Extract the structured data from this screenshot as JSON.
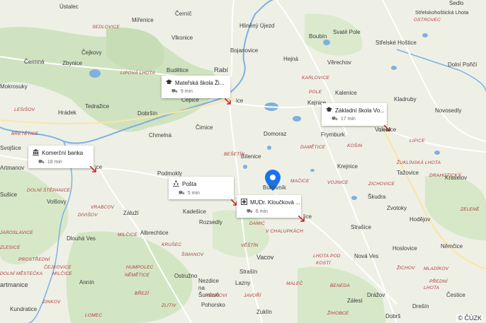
{
  "colors": {
    "land": "#eef0e6",
    "forest": "#cfe3c1",
    "water": "#7fb0df",
    "road": "#ffffff",
    "road_major": "#fbe5a3",
    "pin": "#1a73e8",
    "arrow": "#c62828"
  },
  "towns": [
    {
      "id": "ustalec",
      "name": "Ústalec"
    },
    {
      "id": "cernic",
      "name": "Černíč"
    },
    {
      "id": "sedlo",
      "name": "Sedlo"
    },
    {
      "id": "mirenice",
      "name": "Mířenice"
    },
    {
      "id": "hlineny",
      "name": "Hliněný Újezd"
    },
    {
      "id": "boubin",
      "name": "Boubín"
    },
    {
      "id": "svate-pole",
      "name": "Svaté Pole"
    },
    {
      "id": "strelskohost",
      "name": "Střelskohoštická Lhota"
    },
    {
      "id": "vlkonice",
      "name": "Vlkonice"
    },
    {
      "id": "strelske",
      "name": "Střelské Hoštice"
    },
    {
      "id": "bojanovice",
      "name": "Bojanovice"
    },
    {
      "id": "cejkovy",
      "name": "Čejkovy"
    },
    {
      "id": "hejna",
      "name": "Hejná"
    },
    {
      "id": "cermna",
      "name": "Čermná"
    },
    {
      "id": "zbynice",
      "name": "Zbynice"
    },
    {
      "id": "verechov",
      "name": "Věrechov"
    },
    {
      "id": "dolni-ponci",
      "name": "Dolní Poňčí"
    },
    {
      "id": "budetice",
      "name": "Budětice"
    },
    {
      "id": "rabi",
      "name": "Rabí"
    },
    {
      "id": "mokrosuky",
      "name": "Mokrosuky"
    },
    {
      "id": "kalenice",
      "name": "Kalenice"
    },
    {
      "id": "tedrazice",
      "name": "Tedražice"
    },
    {
      "id": "cepice",
      "name": "Čepice"
    },
    {
      "id": "kejnice",
      "name": "Kejnice"
    },
    {
      "id": "kladruby",
      "name": "Kladruby"
    },
    {
      "id": "hradek",
      "name": "Hrádek"
    },
    {
      "id": "dobrsin",
      "name": "Dobršín"
    },
    {
      "id": "novosedly",
      "name": "Novosedly"
    },
    {
      "id": "cimice",
      "name": "Čimice"
    },
    {
      "id": "chmelna",
      "name": "Chmelná"
    },
    {
      "id": "domoraz",
      "name": "Domoraz"
    },
    {
      "id": "frymburk",
      "name": "Frymburk"
    },
    {
      "id": "volenice",
      "name": "Volenice"
    },
    {
      "id": "svojsice",
      "name": "Svojšice"
    },
    {
      "id": "bilenice",
      "name": "Bílenice"
    },
    {
      "id": "artmanov",
      "name": "Artmanov"
    },
    {
      "id": "krejnice",
      "name": "Krejnice"
    },
    {
      "id": "tazovice",
      "name": "Tažovice"
    },
    {
      "id": "podmokly",
      "name": "Podmokly"
    },
    {
      "id": "kraselov",
      "name": "Kraselov"
    },
    {
      "id": "bukovnik",
      "name": "Bukovník"
    },
    {
      "id": "susice",
      "name": "Sušice"
    },
    {
      "id": "skudra",
      "name": "Škudra"
    },
    {
      "id": "volsovy",
      "name": "Volšovy"
    },
    {
      "id": "zvotoky",
      "name": "Zvotoky"
    },
    {
      "id": "zaluzi",
      "name": "Záluží"
    },
    {
      "id": "kadesice",
      "name": "Kadešice"
    },
    {
      "id": "hodejov",
      "name": "Hodějov"
    },
    {
      "id": "albrechtice",
      "name": "Albrechtice"
    },
    {
      "id": "rozsedly",
      "name": "Rozsedly"
    },
    {
      "id": "strasice",
      "name": "Strašice"
    },
    {
      "id": "dlouha-ves",
      "name": "Dlouhá Ves"
    },
    {
      "id": "hoslovice",
      "name": "Hoslovice"
    },
    {
      "id": "nemcice",
      "name": "Němčice"
    },
    {
      "id": "vacov",
      "name": "Vacov"
    },
    {
      "id": "nova-ves",
      "name": "Nová Ves"
    },
    {
      "id": "strasin",
      "name": "Strašín"
    },
    {
      "id": "ostruzno",
      "name": "Ostružno"
    },
    {
      "id": "annin",
      "name": "Annín"
    },
    {
      "id": "nezdice",
      "name": "Nezdice na Šumavě"
    },
    {
      "id": "lazny",
      "name": "Lazny"
    },
    {
      "id": "artmanice",
      "name": "artmanice"
    },
    {
      "id": "drazov",
      "name": "Drážov"
    },
    {
      "id": "cestice",
      "name": "Čestice"
    },
    {
      "id": "zalesi",
      "name": "Zálesí"
    },
    {
      "id": "pohorsko",
      "name": "Pohorsko"
    },
    {
      "id": "kundratice",
      "name": "Kundratice"
    },
    {
      "id": "zuklin",
      "name": "Zuklín"
    },
    {
      "id": "dobra",
      "name": "Dobrš"
    },
    {
      "id": "dresin",
      "name": "Drešín"
    },
    {
      "id": "ice1",
      "name": "ice"
    },
    {
      "id": "ice2",
      "name": "ice"
    },
    {
      "id": "lice",
      "name": "lice"
    },
    {
      "id": "nice",
      "name": "nice"
    }
  ],
  "villages": [
    {
      "id": "sedlovice",
      "name": "SEDLOVICE"
    },
    {
      "id": "ostrovec",
      "name": "OSTROVEC"
    },
    {
      "id": "lipova-lhota",
      "name": "LIPOVÁ LHOTA"
    },
    {
      "id": "karlovice",
      "name": "KARLOVICE"
    },
    {
      "id": "lesisov",
      "name": "LEŠIŠOV"
    },
    {
      "id": "pole",
      "name": "POLE"
    },
    {
      "id": "bretetice",
      "name": "BŘETĚTICE"
    },
    {
      "id": "kosin",
      "name": "KOŠIN"
    },
    {
      "id": "besetin",
      "name": "BEŠETÍN"
    },
    {
      "id": "dametice",
      "name": "DAMĚTICE"
    },
    {
      "id": "lipice",
      "name": "LIPICE"
    },
    {
      "id": "zuklinska",
      "name": "ŽUKLÍNSKÁ LHOTA"
    },
    {
      "id": "dolni-stepanice",
      "name": "DOLNÍ ŠTĚPANICE"
    },
    {
      "id": "vojnice",
      "name": "VOJNICE"
    },
    {
      "id": "macice",
      "name": "MAČICE"
    },
    {
      "id": "zichovice",
      "name": "ZICHOVICE"
    },
    {
      "id": "vrabcov",
      "name": "VRABCOV"
    },
    {
      "id": "divisov",
      "name": "DIVIŠOV"
    },
    {
      "id": "milcice1",
      "name": "MILČICE"
    },
    {
      "id": "damic",
      "name": "DAMIĆ"
    },
    {
      "id": "v-chalupkach",
      "name": "V CHALUPKÁCH"
    },
    {
      "id": "vestin",
      "name": "VĚŠTÍN"
    },
    {
      "id": "jaroslavic",
      "name": "JAROSLAVICE"
    },
    {
      "id": "lhota-pod",
      "name": "LHOTA POD"
    },
    {
      "id": "kosti",
      "name": "KOSTÍ"
    },
    {
      "id": "prostredni",
      "name": "PROSTŘEDNÍ"
    },
    {
      "id": "krusec",
      "name": "KRUŠEC"
    },
    {
      "id": "simanov",
      "name": "ŠIMANOV"
    },
    {
      "id": "humpolec",
      "name": "HUMPOLEC"
    },
    {
      "id": "nemetice",
      "name": "NĚMĚTICE"
    },
    {
      "id": "dolni-mest",
      "name": "DOLNÍ MĚSTEČKA"
    },
    {
      "id": "milcice2",
      "name": "MILČICE"
    },
    {
      "id": "mladikov",
      "name": "MLADÍKOV"
    },
    {
      "id": "benda",
      "name": "BENEDA"
    },
    {
      "id": "zelene",
      "name": "ZELENÉ"
    },
    {
      "id": "malec",
      "name": "MALEČ"
    },
    {
      "id": "zlesice",
      "name": "ZLESICE"
    },
    {
      "id": "cejkovice",
      "name": "ČEJKOVICE"
    },
    {
      "id": "javori",
      "name": "JAVOŘÍ"
    },
    {
      "id": "zlitiv",
      "name": "ZLITIV"
    },
    {
      "id": "lomec",
      "name": "LOMEC"
    },
    {
      "id": "predni",
      "name": "PŘEDNÍ"
    },
    {
      "id": "lhota2",
      "name": "LHOTA"
    },
    {
      "id": "zichov",
      "name": "ŽICHOV"
    },
    {
      "id": "drahoticky",
      "name": "DRAHOTICKÝ"
    },
    {
      "id": "zichovec",
      "name": "ŽIHOBCE"
    },
    {
      "id": "zinkov",
      "name": "ZINKOV"
    },
    {
      "id": "brezi",
      "name": "BŘEZÍ"
    },
    {
      "id": "pechovi",
      "name": "PĚCHOVI"
    }
  ],
  "pois": [
    {
      "id": "materska",
      "name": "Mateřská škola Ži...",
      "icon": "school-icon",
      "time": "9 min"
    },
    {
      "id": "zakladni",
      "name": "Základní škola Vo...",
      "icon": "school-icon",
      "time": "17 min"
    },
    {
      "id": "komercni",
      "name": "Komerční banka",
      "icon": "bank-icon",
      "time": "18 min"
    },
    {
      "id": "posta",
      "name": "Pošta",
      "icon": "post-icon",
      "time": "5 min"
    },
    {
      "id": "mudr",
      "name": "MUDr. Kloučková ...",
      "icon": "medical-icon",
      "time": "6 min"
    }
  ],
  "copyright": "© ČÚZK"
}
